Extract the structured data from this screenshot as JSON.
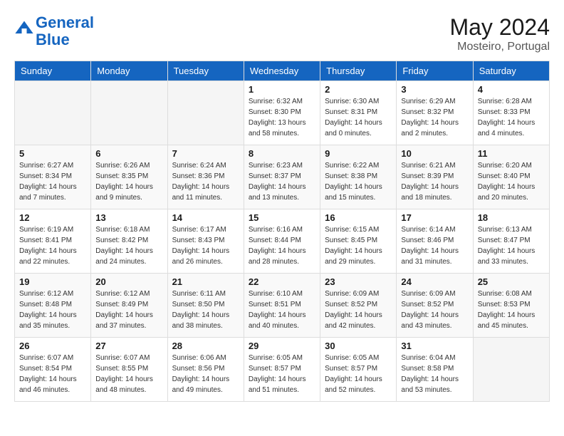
{
  "header": {
    "logo_line1": "General",
    "logo_line2": "Blue",
    "month_title": "May 2024",
    "location": "Mosteiro, Portugal"
  },
  "days_of_week": [
    "Sunday",
    "Monday",
    "Tuesday",
    "Wednesday",
    "Thursday",
    "Friday",
    "Saturday"
  ],
  "weeks": [
    [
      {
        "day": "",
        "info": ""
      },
      {
        "day": "",
        "info": ""
      },
      {
        "day": "",
        "info": ""
      },
      {
        "day": "1",
        "info": "Sunrise: 6:32 AM\nSunset: 8:30 PM\nDaylight: 13 hours\nand 58 minutes."
      },
      {
        "day": "2",
        "info": "Sunrise: 6:30 AM\nSunset: 8:31 PM\nDaylight: 14 hours\nand 0 minutes."
      },
      {
        "day": "3",
        "info": "Sunrise: 6:29 AM\nSunset: 8:32 PM\nDaylight: 14 hours\nand 2 minutes."
      },
      {
        "day": "4",
        "info": "Sunrise: 6:28 AM\nSunset: 8:33 PM\nDaylight: 14 hours\nand 4 minutes."
      }
    ],
    [
      {
        "day": "5",
        "info": "Sunrise: 6:27 AM\nSunset: 8:34 PM\nDaylight: 14 hours\nand 7 minutes."
      },
      {
        "day": "6",
        "info": "Sunrise: 6:26 AM\nSunset: 8:35 PM\nDaylight: 14 hours\nand 9 minutes."
      },
      {
        "day": "7",
        "info": "Sunrise: 6:24 AM\nSunset: 8:36 PM\nDaylight: 14 hours\nand 11 minutes."
      },
      {
        "day": "8",
        "info": "Sunrise: 6:23 AM\nSunset: 8:37 PM\nDaylight: 14 hours\nand 13 minutes."
      },
      {
        "day": "9",
        "info": "Sunrise: 6:22 AM\nSunset: 8:38 PM\nDaylight: 14 hours\nand 15 minutes."
      },
      {
        "day": "10",
        "info": "Sunrise: 6:21 AM\nSunset: 8:39 PM\nDaylight: 14 hours\nand 18 minutes."
      },
      {
        "day": "11",
        "info": "Sunrise: 6:20 AM\nSunset: 8:40 PM\nDaylight: 14 hours\nand 20 minutes."
      }
    ],
    [
      {
        "day": "12",
        "info": "Sunrise: 6:19 AM\nSunset: 8:41 PM\nDaylight: 14 hours\nand 22 minutes."
      },
      {
        "day": "13",
        "info": "Sunrise: 6:18 AM\nSunset: 8:42 PM\nDaylight: 14 hours\nand 24 minutes."
      },
      {
        "day": "14",
        "info": "Sunrise: 6:17 AM\nSunset: 8:43 PM\nDaylight: 14 hours\nand 26 minutes."
      },
      {
        "day": "15",
        "info": "Sunrise: 6:16 AM\nSunset: 8:44 PM\nDaylight: 14 hours\nand 28 minutes."
      },
      {
        "day": "16",
        "info": "Sunrise: 6:15 AM\nSunset: 8:45 PM\nDaylight: 14 hours\nand 29 minutes."
      },
      {
        "day": "17",
        "info": "Sunrise: 6:14 AM\nSunset: 8:46 PM\nDaylight: 14 hours\nand 31 minutes."
      },
      {
        "day": "18",
        "info": "Sunrise: 6:13 AM\nSunset: 8:47 PM\nDaylight: 14 hours\nand 33 minutes."
      }
    ],
    [
      {
        "day": "19",
        "info": "Sunrise: 6:12 AM\nSunset: 8:48 PM\nDaylight: 14 hours\nand 35 minutes."
      },
      {
        "day": "20",
        "info": "Sunrise: 6:12 AM\nSunset: 8:49 PM\nDaylight: 14 hours\nand 37 minutes."
      },
      {
        "day": "21",
        "info": "Sunrise: 6:11 AM\nSunset: 8:50 PM\nDaylight: 14 hours\nand 38 minutes."
      },
      {
        "day": "22",
        "info": "Sunrise: 6:10 AM\nSunset: 8:51 PM\nDaylight: 14 hours\nand 40 minutes."
      },
      {
        "day": "23",
        "info": "Sunrise: 6:09 AM\nSunset: 8:52 PM\nDaylight: 14 hours\nand 42 minutes."
      },
      {
        "day": "24",
        "info": "Sunrise: 6:09 AM\nSunset: 8:52 PM\nDaylight: 14 hours\nand 43 minutes."
      },
      {
        "day": "25",
        "info": "Sunrise: 6:08 AM\nSunset: 8:53 PM\nDaylight: 14 hours\nand 45 minutes."
      }
    ],
    [
      {
        "day": "26",
        "info": "Sunrise: 6:07 AM\nSunset: 8:54 PM\nDaylight: 14 hours\nand 46 minutes."
      },
      {
        "day": "27",
        "info": "Sunrise: 6:07 AM\nSunset: 8:55 PM\nDaylight: 14 hours\nand 48 minutes."
      },
      {
        "day": "28",
        "info": "Sunrise: 6:06 AM\nSunset: 8:56 PM\nDaylight: 14 hours\nand 49 minutes."
      },
      {
        "day": "29",
        "info": "Sunrise: 6:05 AM\nSunset: 8:57 PM\nDaylight: 14 hours\nand 51 minutes."
      },
      {
        "day": "30",
        "info": "Sunrise: 6:05 AM\nSunset: 8:57 PM\nDaylight: 14 hours\nand 52 minutes."
      },
      {
        "day": "31",
        "info": "Sunrise: 6:04 AM\nSunset: 8:58 PM\nDaylight: 14 hours\nand 53 minutes."
      },
      {
        "day": "",
        "info": ""
      }
    ]
  ]
}
